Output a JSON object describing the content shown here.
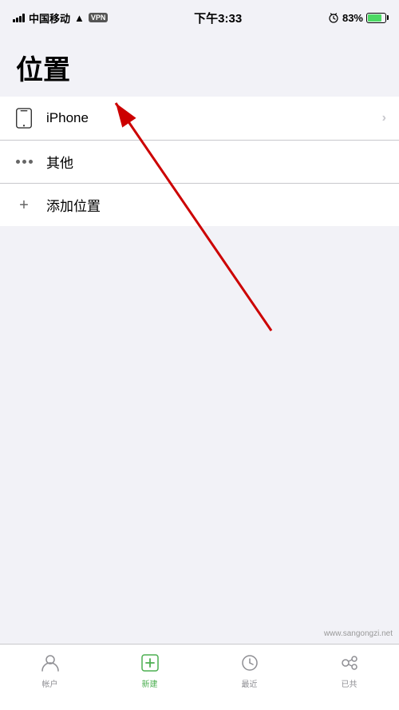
{
  "statusBar": {
    "carrier": "中国移动",
    "wifi": "WiFi",
    "vpn": "VPN",
    "time": "下午3:33",
    "battery": "83%"
  },
  "page": {
    "title": "位置"
  },
  "list": {
    "items": [
      {
        "id": "iphone",
        "icon": "phone-icon",
        "label": "iPhone",
        "hasChevron": true
      },
      {
        "id": "other",
        "icon": "dots-icon",
        "label": "其他",
        "hasChevron": false
      },
      {
        "id": "add-location",
        "icon": "plus-icon",
        "label": "添加位置",
        "hasChevron": false
      }
    ]
  },
  "tabBar": {
    "items": [
      {
        "id": "account",
        "label": "帐户",
        "active": false
      },
      {
        "id": "new",
        "label": "新建",
        "active": false
      },
      {
        "id": "recent",
        "label": "最近",
        "active": false
      },
      {
        "id": "shared",
        "label": "已共",
        "active": false
      }
    ]
  },
  "watermark": "www.sangongzi.net"
}
